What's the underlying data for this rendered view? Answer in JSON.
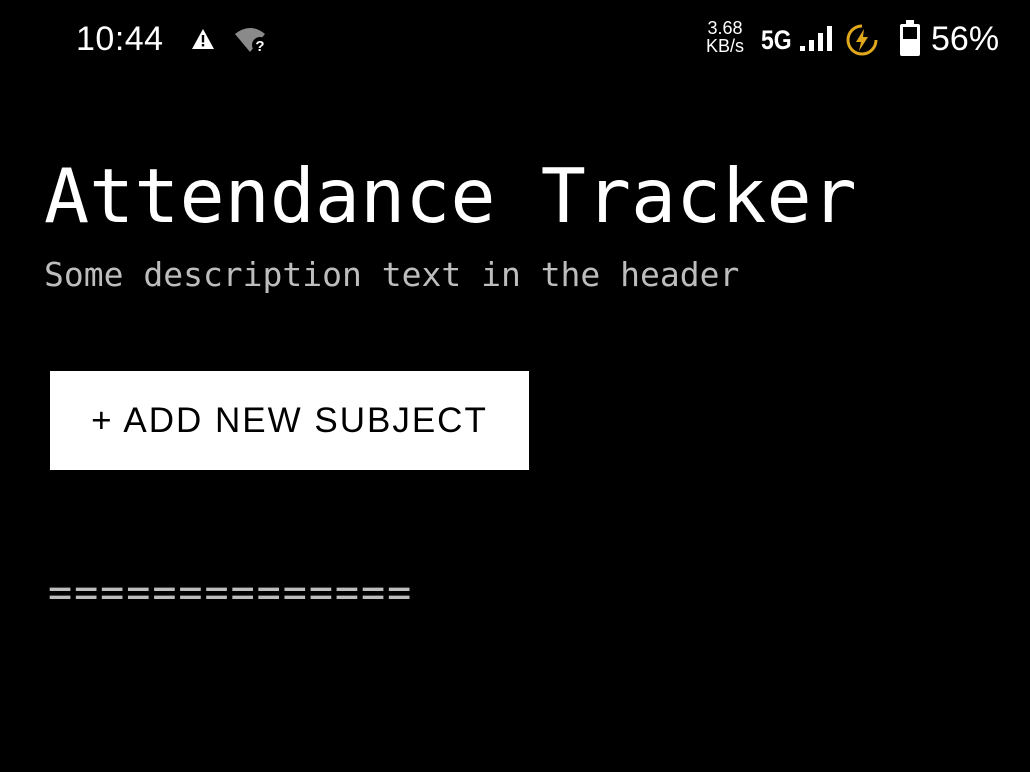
{
  "status_bar": {
    "time": "10:44",
    "net_speed_value": "3.68",
    "net_speed_unit": "KB/s",
    "network_type": "5G",
    "battery_percent": "56%",
    "icons": [
      "alert-icon",
      "wifi-unknown-icon",
      "cell-signal-icon",
      "battery-saver-icon",
      "battery-icon"
    ],
    "saver_color": "#e0a81a"
  },
  "header": {
    "title": "Attendance Tracker",
    "subtitle": "Some description text in the header"
  },
  "actions": {
    "add_subject_label": "+ ADD NEW SUBJECT"
  },
  "divider": {
    "text": "=============="
  },
  "colors": {
    "background": "#000000",
    "text": "#ffffff",
    "muted_text": "#bdbdbd",
    "button_bg": "#ffffff",
    "button_text": "#000000"
  }
}
